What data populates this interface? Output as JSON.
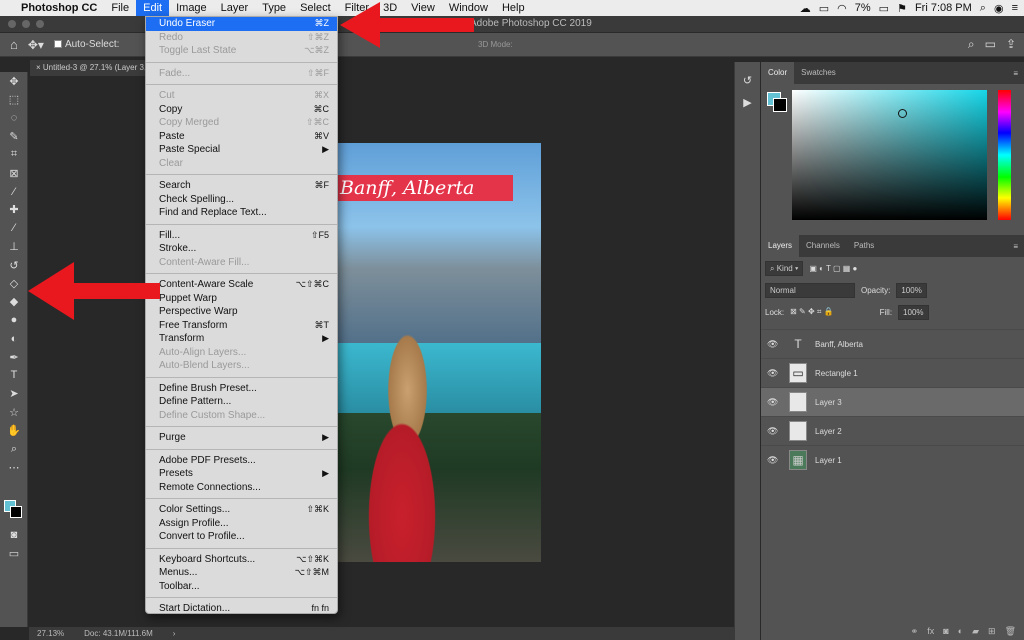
{
  "menubar": {
    "apple": "",
    "items": [
      "Photoshop CC",
      "File",
      "Edit",
      "Image",
      "Layer",
      "Type",
      "Select",
      "Filter",
      "3D",
      "View",
      "Window",
      "Help"
    ],
    "battery": "7%",
    "clock": "Fri 7:08 PM"
  },
  "window_title": "Adobe Photoshop CC 2019",
  "options_bar": {
    "auto_select": "Auto-Select:",
    "mode_3d": "3D Mode:"
  },
  "doc_tab": "Untitled-3 @ 27.1% (Layer 3, RGB/8)",
  "status": {
    "zoom": "27.13%",
    "doc": "Doc: 43.1M/111.6M"
  },
  "canvas": {
    "banner_text": "Banff, Alberta"
  },
  "color_panel": {
    "tabs": [
      "Color",
      "Swatches"
    ],
    "fg_color": "#62c1d2",
    "bg_color": "#000000"
  },
  "layers_panel": {
    "tabs": [
      "Layers",
      "Channels",
      "Paths"
    ],
    "filter": "Kind",
    "blend_mode": "Normal",
    "opacity_label": "Opacity:",
    "opacity": "100%",
    "lock_label": "Lock:",
    "fill_label": "Fill:",
    "fill": "100%",
    "layers": [
      {
        "name": "Banff, Alberta",
        "thumb": "T"
      },
      {
        "name": "Rectangle 1",
        "thumb": "▭"
      },
      {
        "name": "Layer 3",
        "thumb": ""
      },
      {
        "name": "Layer 2",
        "thumb": ""
      },
      {
        "name": "Layer 1",
        "thumb": "▦"
      }
    ]
  },
  "edit_menu": {
    "undo": {
      "label": "Undo Eraser",
      "sc": "⌘Z"
    },
    "redo": {
      "label": "Redo",
      "sc": "⇧⌘Z"
    },
    "toggle": {
      "label": "Toggle Last State",
      "sc": "⌥⌘Z"
    },
    "fade": {
      "label": "Fade...",
      "sc": "⇧⌘F"
    },
    "cut": {
      "label": "Cut",
      "sc": "⌘X"
    },
    "copy": {
      "label": "Copy",
      "sc": "⌘C"
    },
    "copy_merged": {
      "label": "Copy Merged",
      "sc": "⇧⌘C"
    },
    "paste": {
      "label": "Paste",
      "sc": "⌘V"
    },
    "paste_special": {
      "label": "Paste Special",
      "sc": "▶"
    },
    "clear": {
      "label": "Clear",
      "sc": ""
    },
    "search": {
      "label": "Search",
      "sc": "⌘F"
    },
    "spelling": {
      "label": "Check Spelling...",
      "sc": ""
    },
    "find_replace": {
      "label": "Find and Replace Text...",
      "sc": ""
    },
    "fill": {
      "label": "Fill...",
      "sc": "⇧F5"
    },
    "stroke": {
      "label": "Stroke...",
      "sc": ""
    },
    "content_aware_fill": {
      "label": "Content-Aware Fill...",
      "sc": ""
    },
    "content_aware_scale": {
      "label": "Content-Aware Scale",
      "sc": "⌥⇧⌘C"
    },
    "puppet_warp": {
      "label": "Puppet Warp",
      "sc": ""
    },
    "perspective_warp": {
      "label": "Perspective Warp",
      "sc": ""
    },
    "free_transform": {
      "label": "Free Transform",
      "sc": "⌘T"
    },
    "transform": {
      "label": "Transform",
      "sc": "▶"
    },
    "auto_align": {
      "label": "Auto-Align Layers...",
      "sc": ""
    },
    "auto_blend": {
      "label": "Auto-Blend Layers...",
      "sc": ""
    },
    "brush_preset": {
      "label": "Define Brush Preset...",
      "sc": ""
    },
    "pattern": {
      "label": "Define Pattern...",
      "sc": ""
    },
    "custom_shape": {
      "label": "Define Custom Shape...",
      "sc": ""
    },
    "purge": {
      "label": "Purge",
      "sc": "▶"
    },
    "pdf_presets": {
      "label": "Adobe PDF Presets...",
      "sc": ""
    },
    "presets": {
      "label": "Presets",
      "sc": "▶"
    },
    "remote": {
      "label": "Remote Connections...",
      "sc": ""
    },
    "color_settings": {
      "label": "Color Settings...",
      "sc": "⇧⌘K"
    },
    "assign_profile": {
      "label": "Assign Profile...",
      "sc": ""
    },
    "convert_profile": {
      "label": "Convert to Profile...",
      "sc": ""
    },
    "keyboard": {
      "label": "Keyboard Shortcuts...",
      "sc": "⌥⇧⌘K"
    },
    "menus": {
      "label": "Menus...",
      "sc": "⌥⇧⌘M"
    },
    "toolbar": {
      "label": "Toolbar...",
      "sc": ""
    },
    "dictation": {
      "label": "Start Dictation...",
      "sc": "fn fn"
    }
  },
  "colors": {
    "accent": "#1d6ef2",
    "arrow": "#e8181e"
  }
}
